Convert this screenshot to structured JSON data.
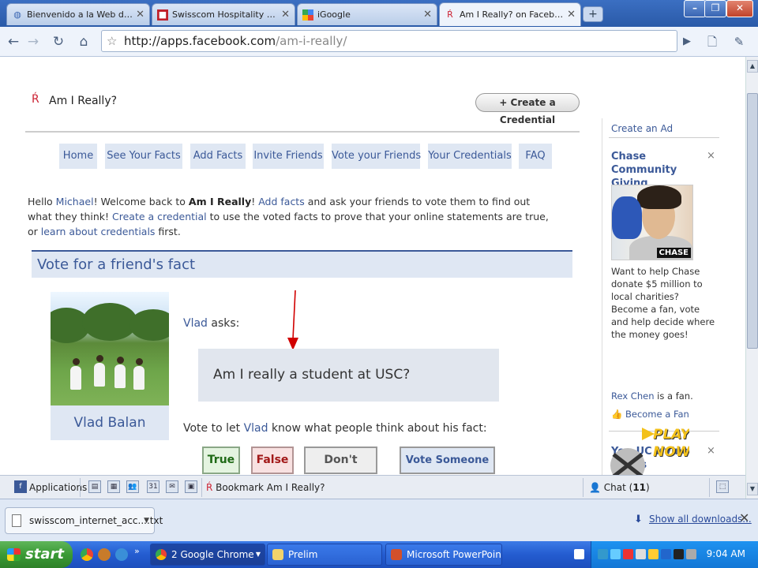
{
  "browser": {
    "tabs": [
      {
        "title": "Bienvenido a la Web de Ae...",
        "icon": "globe-icon"
      },
      {
        "title": "Swisscom Hospitality Servic...",
        "icon": "swisscom-icon"
      },
      {
        "title": "iGoogle",
        "icon": "google-icon"
      },
      {
        "title": "Am I Really? on Facebook",
        "icon": "ami-really-icon",
        "active": true
      }
    ],
    "url_host": "http://apps.facebook.com",
    "url_path": "/am-i-really/",
    "window_controls": [
      "–",
      "❐",
      "✕"
    ]
  },
  "app": {
    "name": "Am I Really?",
    "create_button": "+ Create a Credential",
    "nav": [
      "Home",
      "See Your Facts",
      "Add Facts",
      "Invite Friends",
      "Vote your Friends",
      "Your Credentials",
      "FAQ"
    ],
    "welcome": {
      "hello": "Hello ",
      "user": "Michael",
      "t1": "! Welcome back to ",
      "brand": "Am I Really",
      "t2": "! ",
      "link_add": "Add facts",
      "t3": " and ask your friends to vote them to find out what they think! ",
      "link_create": "Create a credential",
      "t4": " to use the voted facts to prove that your online statements are true, or ",
      "link_learn": "learn about credentials",
      "t5": " first."
    },
    "section_title": "Vote for a friend's fact",
    "friend_name": "Vlad Balan",
    "asker": "Vlad",
    "asks_suffix": " asks:",
    "fact": "Am I really a student at USC?",
    "vote_prefix": "Vote to let ",
    "vote_name": "Vlad",
    "vote_suffix": " know what people think about his fact:",
    "buttons": {
      "true": "True",
      "false": "False",
      "dont_know": "Don't Know",
      "someone_else": "Vote Someone Else"
    },
    "colors": {
      "fb_blue": "#3b5998",
      "panel": "#dfe7f3"
    }
  },
  "ads": {
    "create_ad": "Create an Ad",
    "ad1": {
      "title": "Chase Community Giving",
      "logo_text": "CHASE",
      "body": "Want to help Chase donate $5 million to local charities? Become a fan, vote and help decide where the money goes!",
      "fan_name": "Rex Chen",
      "fan_suffix": " is a fan.",
      "become_fan": "Become a Fan"
    },
    "ad2": {
      "title": "Yo - UC Irvine Alums",
      "image_text": "PLAY NOW"
    },
    "close": "×"
  },
  "fb_bar": {
    "applications": "Applications",
    "bookmark": "Bookmark Am I Really?",
    "chat_label": "Chat (",
    "chat_count": "11",
    "chat_close": ")"
  },
  "downloads": {
    "file": "swisscom_internet_acc....txt",
    "show_all": "Show all downloads...",
    "close": "✕"
  },
  "taskbar": {
    "start": "start",
    "tasks": [
      {
        "label": "2 Google Chrome",
        "active": true
      },
      {
        "label": "Prelim"
      },
      {
        "label": "Microsoft PowerPoint ..."
      }
    ],
    "time": "9:04 AM"
  }
}
